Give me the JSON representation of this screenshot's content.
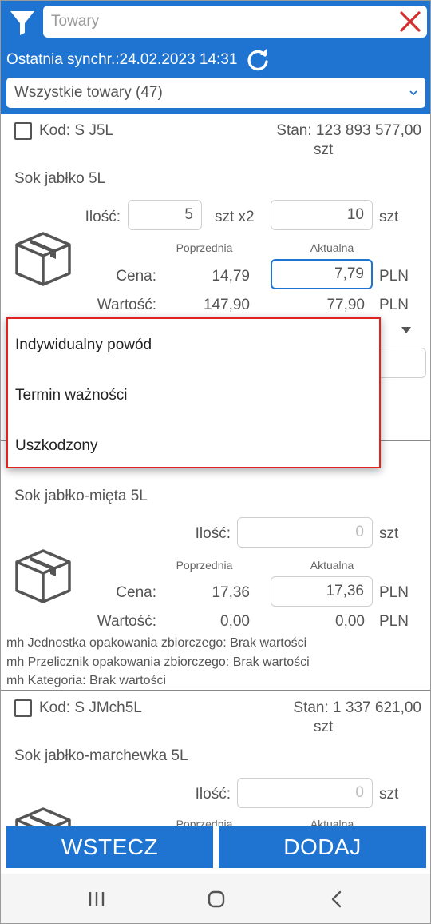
{
  "header": {
    "search_placeholder": "Towary",
    "sync_text": "Ostatnia synchr.:24.02.2023 14:31",
    "filter_select": "Wszystkie towary (47)",
    "accent_color": "#1e74d0",
    "clear_icon_color": "#d32f2f"
  },
  "products": [
    {
      "kod": "Kod: S J5L",
      "stan_value": "Stan: 123 893 577,00",
      "stan_unit": "szt",
      "name": "Sok jabłko 5L",
      "ilosc_label": "Ilość:",
      "ilosc_value": "5",
      "ilosc_unit": "szt x2",
      "ilosc_total": "10",
      "ilosc_total_unit": "szt",
      "hdr_prev": "Poprzednia",
      "hdr_curr": "Aktualna",
      "cena_label": "Cena:",
      "cena_prev": "14,79",
      "cena_curr": "7,79",
      "cena_unit": "PLN",
      "wartosc_label": "Wartość:",
      "wartosc_prev": "147,90",
      "wartosc_curr": "77,90",
      "wartosc_unit": "PLN"
    },
    {
      "name": "Sok jabłko-mięta 5L",
      "ilosc_label": "Ilość:",
      "ilosc_value": "0",
      "ilosc_unit": "szt",
      "hdr_prev": "Poprzednia",
      "hdr_curr": "Aktualna",
      "cena_label": "Cena:",
      "cena_prev": "17,36",
      "cena_curr": "17,36",
      "cena_unit": "PLN",
      "wartosc_label": "Wartość:",
      "wartosc_prev": "0,00",
      "wartosc_curr": "0,00",
      "wartosc_unit": "PLN",
      "attrs": [
        "mh Jednostka opakowania zbiorczego: Brak wartości",
        "mh Przelicznik opakowania zbiorczego: Brak wartości",
        "mh Kategoria: Brak wartości"
      ]
    },
    {
      "kod": "Kod: S JMch5L",
      "stan_value": "Stan: 1 337 621,00",
      "stan_unit": "szt",
      "name": "Sok jabłko-marchewka 5L",
      "ilosc_label": "Ilość:",
      "ilosc_value": "0",
      "ilosc_unit": "szt",
      "hdr_prev": "Poprzednia",
      "hdr_curr": "Aktualna"
    }
  ],
  "reason_popup": {
    "options": [
      "Indywidualny powód",
      "Termin ważności",
      "Uszkodzony"
    ],
    "highlight_color": "#e0231f"
  },
  "actions": {
    "back_label": "WSTECZ",
    "add_label": "DODAJ"
  },
  "system_nav": {
    "recent_icon": "recent-apps-icon",
    "home_icon": "home-icon",
    "back_icon": "back-icon"
  }
}
